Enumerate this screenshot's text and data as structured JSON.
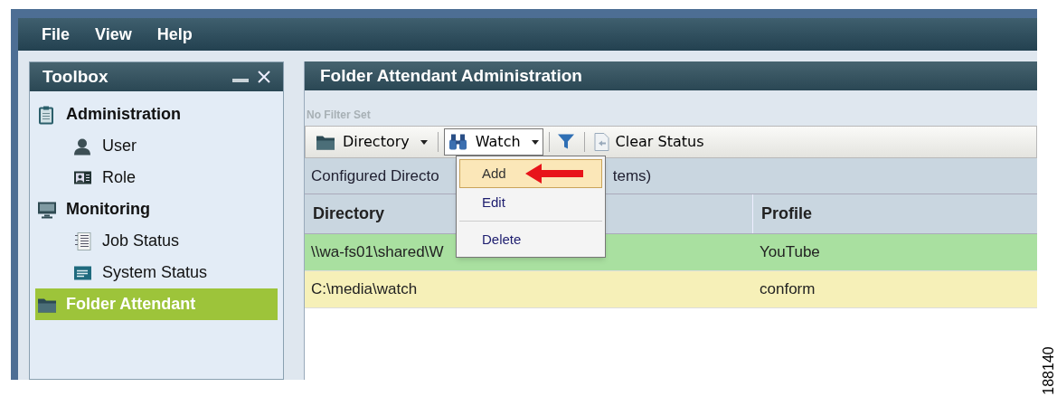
{
  "menubar": [
    "File",
    "View",
    "Help"
  ],
  "toolbox": {
    "title": "Toolbox",
    "items": [
      {
        "label": "Administration",
        "selected": false,
        "children": [
          {
            "label": "User",
            "selected": false
          },
          {
            "label": "Role",
            "selected": false
          }
        ]
      },
      {
        "label": "Monitoring",
        "selected": false,
        "children": [
          {
            "label": "Job Status",
            "selected": false
          },
          {
            "label": "System Status",
            "selected": false
          }
        ]
      },
      {
        "label": "Folder Attendant",
        "selected": true
      }
    ]
  },
  "main": {
    "title": "Folder Attendant Administration",
    "filter_status": "No Filter Set",
    "toolbar": [
      {
        "kind": "dropdown",
        "label": "Directory",
        "expanded": false
      },
      {
        "kind": "dropdown",
        "label": "Watch",
        "expanded": true
      },
      {
        "kind": "icon"
      },
      {
        "kind": "button",
        "label": "Clear Status"
      }
    ],
    "menu": [
      {
        "label": "Add",
        "selected": true
      },
      {
        "label": "Edit",
        "selected": false
      },
      {
        "label": "Delete",
        "selected": false
      }
    ],
    "caption": [
      "Configured Directo",
      "tems)"
    ],
    "columns": [
      "Directory",
      "Profile"
    ],
    "rows": [
      {
        "cells": [
          "\\\\wa-fs01\\shared\\W",
          "YouTube"
        ],
        "color": "#a9e0a0"
      },
      {
        "cells": [
          "C:\\media\\watch",
          "conform"
        ],
        "color": "#f6f0b8"
      }
    ]
  },
  "figure_number": "188140"
}
